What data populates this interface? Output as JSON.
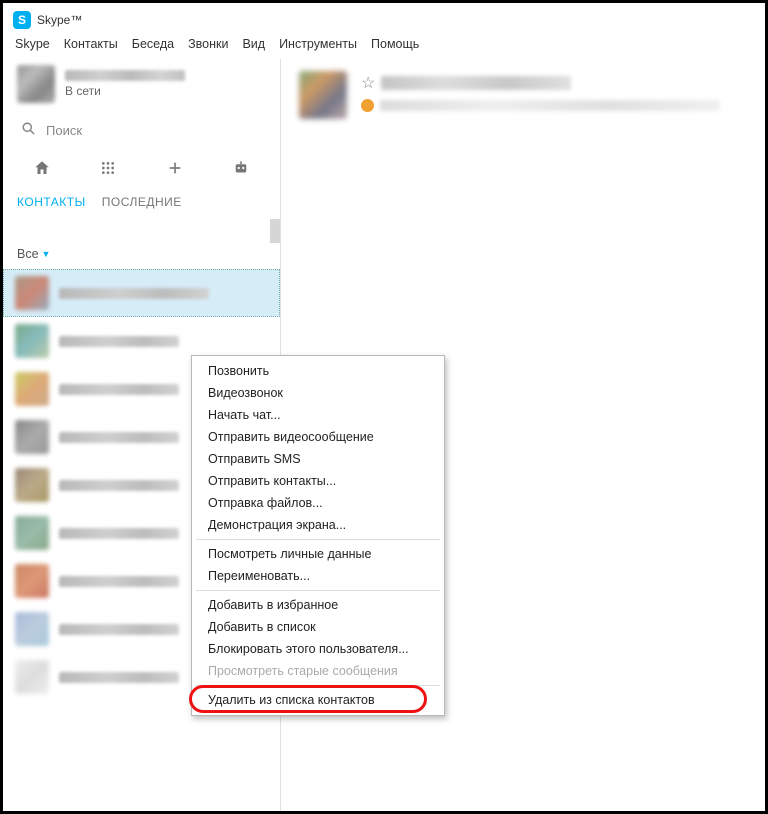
{
  "window": {
    "title": "Skype™"
  },
  "menu": [
    "Skype",
    "Контакты",
    "Беседа",
    "Звонки",
    "Вид",
    "Инструменты",
    "Помощь"
  ],
  "profile": {
    "status": "В сети"
  },
  "search": {
    "placeholder": "Поиск"
  },
  "tabs": {
    "contacts": "КОНТАКТЫ",
    "recent": "ПОСЛЕДНИЕ"
  },
  "filter": {
    "label": "Все"
  },
  "contacts_count": 9,
  "context_menu": {
    "groups": [
      [
        "Позвонить",
        "Видеозвонок",
        "Начать чат...",
        "Отправить видеосообщение",
        "Отправить SMS",
        "Отправить контакты...",
        "Отправка файлов...",
        "Демонстрация экрана..."
      ],
      [
        "Посмотреть личные данные",
        "Переименовать..."
      ],
      [
        "Добавить в избранное",
        "Добавить в список",
        "Блокировать этого пользователя..."
      ]
    ],
    "disabled_item": "Просмотреть старые сообщения",
    "highlighted_item": "Удалить из списка контактов"
  }
}
